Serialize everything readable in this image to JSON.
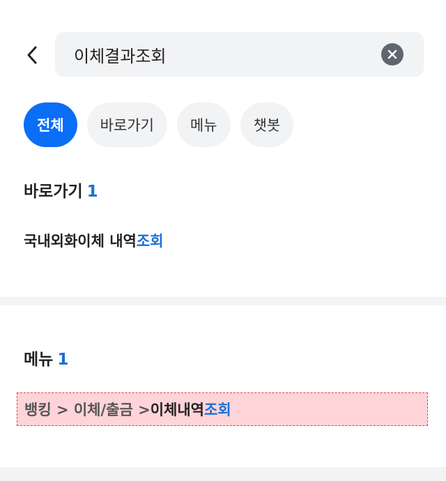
{
  "search": {
    "value": "이체결과조회"
  },
  "filters": [
    {
      "label": "전체",
      "active": true
    },
    {
      "label": "바로가기",
      "active": false
    },
    {
      "label": "메뉴",
      "active": false
    },
    {
      "label": "챗봇",
      "active": false
    }
  ],
  "shortcuts_section": {
    "title": "바로가기",
    "count": "1",
    "item_prefix": "국내외화이체 내역",
    "item_highlight": "조회"
  },
  "menu_section": {
    "title": "메뉴",
    "count": "1",
    "path_prefix": "뱅킹 > 이체/출금 > ",
    "leaf_prefix": "이체내역",
    "leaf_highlight": "조회"
  },
  "colors": {
    "accent": "#0a6ef7",
    "highlight": "#1b6fd8",
    "focus_outline": "#e53a46",
    "focus_fill": "#ffd4d8"
  }
}
